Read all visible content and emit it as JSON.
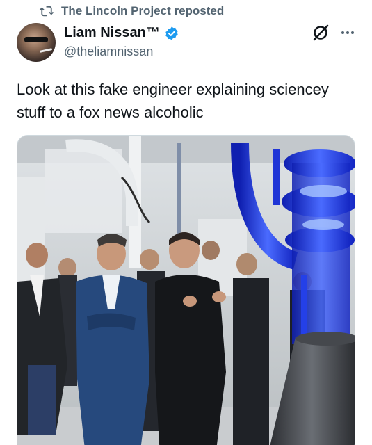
{
  "repost": {
    "icon": "repost-icon",
    "label": "The Lincoln Project reposted"
  },
  "author": {
    "display_name": "Liam Nissan™",
    "verified": true,
    "verified_icon": "verified-badge-icon",
    "handle": "@theliamnissan"
  },
  "actions": {
    "grok_icon": "grok-icon",
    "more_icon": "more-options-icon"
  },
  "tweet": {
    "text": "Look at this fake engineer explaining sciencey stuff to a fox news alcoholic"
  },
  "media": {
    "type": "photo"
  },
  "colors": {
    "text_primary": "#0f1419",
    "text_secondary": "#536471",
    "verified_blue": "#1d9bf0",
    "rocket_blue": "#2b4dff"
  }
}
